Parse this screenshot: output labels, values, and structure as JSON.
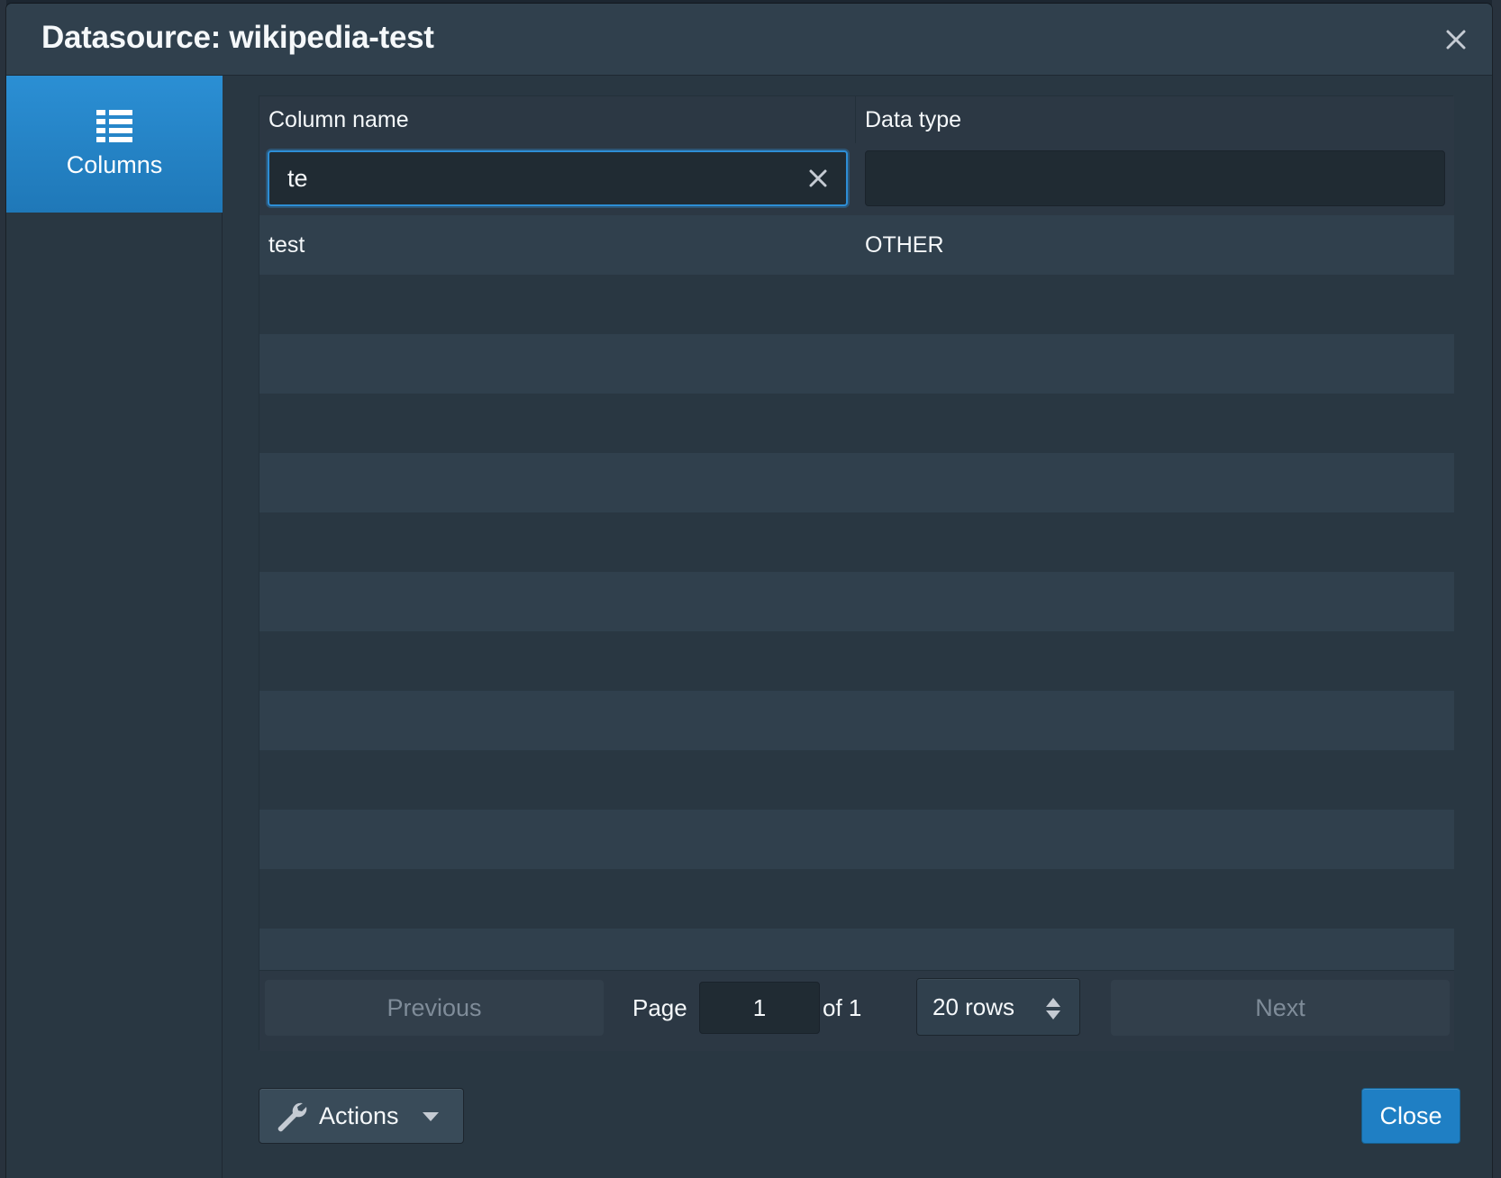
{
  "dialog": {
    "title": "Datasource: wikipedia-test"
  },
  "sidebar": {
    "tabs": [
      {
        "label": "Columns",
        "icon": "list-columns-icon",
        "active": true
      }
    ]
  },
  "table": {
    "headers": [
      "Column name",
      "Data type"
    ],
    "filters": {
      "column_name_value": "te",
      "data_type_value": ""
    },
    "rows": [
      {
        "name": "test",
        "type": "OTHER"
      }
    ],
    "empty_row_count": 12
  },
  "pagination": {
    "previous_label": "Previous",
    "page_label": "Page",
    "current_page": "1",
    "of_label": "of 1",
    "rows_option": "20 rows",
    "next_label": "Next"
  },
  "footer": {
    "actions_label": "Actions",
    "close_label": "Close"
  },
  "colors": {
    "accent": "#2d8ed6",
    "background": "#293742",
    "header": "#30404d"
  }
}
